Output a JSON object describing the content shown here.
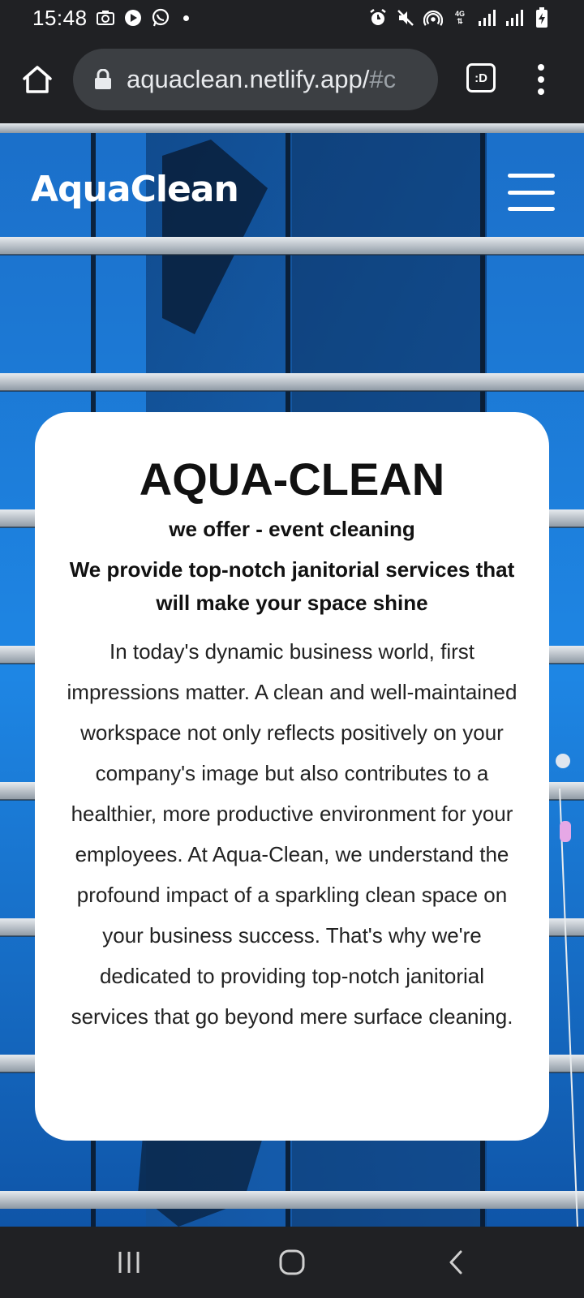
{
  "status_bar": {
    "time": "15:48",
    "left_icons": [
      "screenshot-icon",
      "youtube-icon",
      "whatsapp-icon",
      "notification-dot-icon"
    ],
    "right_icons": [
      "alarm-icon",
      "mute-icon",
      "hotspot-icon",
      "4g-data-icon",
      "signal-icon",
      "signal-icon-2",
      "battery-charging-icon"
    ],
    "network_label": "4G"
  },
  "browser": {
    "url": "aquaclean.netlify.app/",
    "url_fade": "#c",
    "tabs_label": ":D"
  },
  "site": {
    "logo": "AquaClean"
  },
  "card": {
    "title": "AQUA-CLEAN",
    "subtitle": "we offer - event cleaning",
    "tagline": "We provide top-notch janitorial services that will make your space shine",
    "body": "In today's dynamic business world, first impressions matter. A clean and well-maintained workspace not only reflects positively on your company's image but also contributes to a healthier, more productive environment for your employees. At Aqua-Clean, we understand the profound impact of a sparkling clean space on your business success. That's why we're dedicated to providing top-notch janitorial services that go beyond mere surface cleaning."
  },
  "colors": {
    "system_bar": "#202124",
    "url_pill": "#3c3f43",
    "card_bg": "#ffffff",
    "glass_blue": "#1a7ad9",
    "text_dark": "#111111"
  }
}
